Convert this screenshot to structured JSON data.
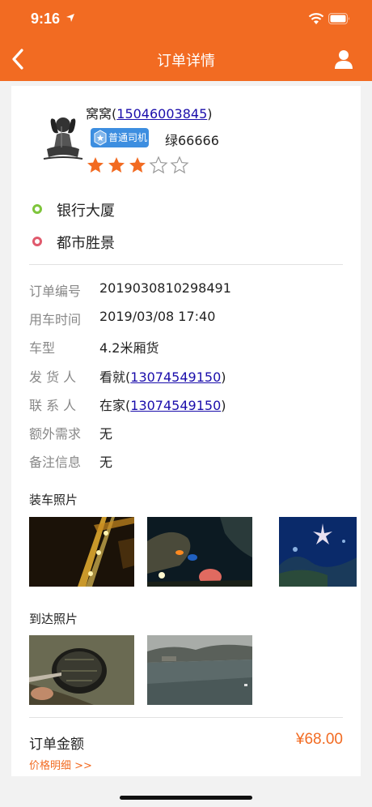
{
  "status_bar": {
    "time": "9:16"
  },
  "navbar": {
    "title": "订单详情",
    "back_icon": "chevron-left-icon",
    "user_icon": "user-icon"
  },
  "driver": {
    "name": "窝窝",
    "phone": "15046003845",
    "badge": "普通司机",
    "plate": "绿66666",
    "rating": 3,
    "rating_max": 5
  },
  "route": {
    "start": "银行大厦",
    "end": "都市胜景"
  },
  "order": {
    "rows": [
      {
        "label": "订单编号",
        "value": "2019030810298491"
      },
      {
        "label": "用车时间",
        "value": "2019/03/08 17:40"
      },
      {
        "label": "车型",
        "value": "4.2米厢货"
      },
      {
        "label": "发 货 人",
        "name": "看就",
        "phone": "13074549150"
      },
      {
        "label": "联 系 人",
        "name": "在家",
        "phone": "13074549150"
      },
      {
        "label": "额外需求",
        "value": "无"
      },
      {
        "label": "备注信息",
        "value": "无"
      }
    ]
  },
  "photos": {
    "loading_title": "装车照片",
    "arrival_title": "到达照片"
  },
  "payment": {
    "label": "订单金额",
    "amount": "¥68.00",
    "detail_link": "价格明细 >>"
  },
  "colors": {
    "brand": "#f26b22",
    "link": "#1a0dab",
    "badge": "#3d8ee0",
    "start_dot": "#7ec53b",
    "end_dot": "#e05a6d"
  }
}
